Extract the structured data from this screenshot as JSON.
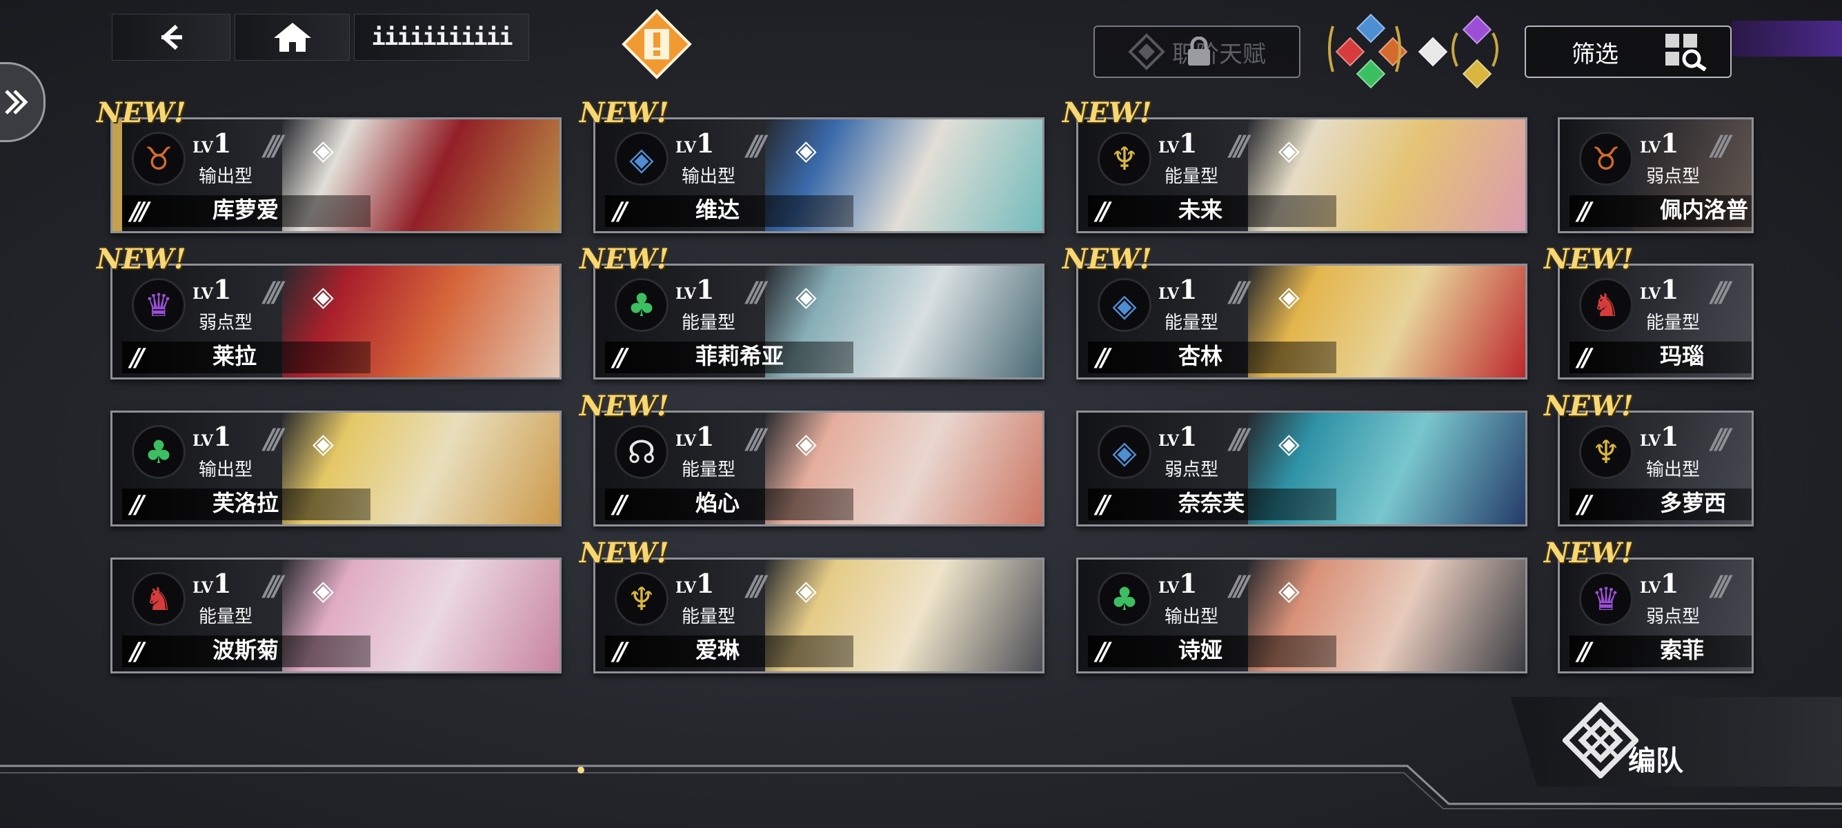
{
  "topbar": {
    "back_icon": "chevron-left-icon",
    "home_icon": "home-icon",
    "title": "iiiiiiiiiii",
    "alert_icon": "exclamation-diamond-icon",
    "locked_label": "职阶天赋",
    "filter_label": "筛选",
    "filter_icon": "grid-search-icon"
  },
  "side": {
    "expand_icon": "double-chevron-right-icon"
  },
  "new_label": "NEW!",
  "lv_prefix": "LV",
  "cards": [
    {
      "name": "库萝爱",
      "role": "输出型",
      "level": "1",
      "stars": "///",
      "is_new": true,
      "emblem": "demon-icon",
      "emblem_color": "#d46a2e",
      "accent": true,
      "art": [
        "#f2efe7",
        "#9b1d26",
        "#c99b47"
      ]
    },
    {
      "name": "维达",
      "role": "输出型",
      "level": "1",
      "stars": "//",
      "is_new": true,
      "emblem": "shield-icon",
      "emblem_color": "#4e8fd4",
      "accent": false,
      "art": [
        "#3b6fb5",
        "#f1ede4",
        "#78c6c6"
      ]
    },
    {
      "name": "未来",
      "role": "能量型",
      "level": "1",
      "stars": "//",
      "is_new": true,
      "emblem": "chalice-icon",
      "emblem_color": "#d8b640",
      "accent": false,
      "art": [
        "#f6ecd4",
        "#f4d07a",
        "#e8a3b8"
      ]
    },
    {
      "name": "佩内洛普",
      "role": "弱点型",
      "level": "1",
      "stars": "//",
      "is_new": false,
      "emblem": "demon-icon",
      "emblem_color": "#d46a2e",
      "accent": false,
      "art": [
        "#3a2f2c",
        "#6d5544",
        "#b48b6a"
      ]
    },
    {
      "name": "莱拉",
      "role": "弱点型",
      "level": "1",
      "stars": "//",
      "is_new": true,
      "emblem": "crown-icon",
      "emblem_color": "#9b4fd6",
      "accent": false,
      "art": [
        "#b51f2b",
        "#e46a3a",
        "#f1d3bf"
      ]
    },
    {
      "name": "菲莉希亚",
      "role": "能量型",
      "level": "1",
      "stars": "//",
      "is_new": true,
      "emblem": "tree-icon",
      "emblem_color": "#3cbf62",
      "accent": false,
      "art": [
        "#8fb9c2",
        "#e6eef0",
        "#4b6d78"
      ]
    },
    {
      "name": "杏林",
      "role": "能量型",
      "level": "1",
      "stars": "//",
      "is_new": true,
      "emblem": "shield-icon",
      "emblem_color": "#4e8fd4",
      "accent": false,
      "art": [
        "#f4c14f",
        "#f7e1a2",
        "#c8262b"
      ]
    },
    {
      "name": "玛瑙",
      "role": "能量型",
      "level": "1",
      "stars": "//",
      "is_new": true,
      "emblem": "wolf-icon",
      "emblem_color": "#d63c3c",
      "accent": false,
      "art": [
        "#2a2c31",
        "#43464c",
        "#5d6067"
      ]
    },
    {
      "name": "芙洛拉",
      "role": "输出型",
      "level": "1",
      "stars": "//",
      "is_new": false,
      "emblem": "tree-icon",
      "emblem_color": "#3cbf62",
      "accent": false,
      "art": [
        "#f5d56a",
        "#f8edc7",
        "#d8a04a"
      ]
    },
    {
      "name": "焰心",
      "role": "能量型",
      "level": "1",
      "stars": "//",
      "is_new": true,
      "emblem": "halo-wing-icon",
      "emblem_color": "#e8e8e8",
      "accent": false,
      "art": [
        "#f5b9a6",
        "#f9e4dc",
        "#d87a64"
      ]
    },
    {
      "name": "奈奈芙",
      "role": "弱点型",
      "level": "1",
      "stars": "//",
      "is_new": false,
      "emblem": "shield-icon",
      "emblem_color": "#4e8fd4",
      "accent": false,
      "art": [
        "#2f9bb0",
        "#7fd3da",
        "#223a6b"
      ]
    },
    {
      "name": "多萝西",
      "role": "输出型",
      "level": "1",
      "stars": "//",
      "is_new": true,
      "emblem": "chalice-icon",
      "emblem_color": "#d8b640",
      "accent": false,
      "art": [
        "#2a2c31",
        "#43464c",
        "#5d6067"
      ]
    },
    {
      "name": "波斯菊",
      "role": "能量型",
      "level": "1",
      "stars": "//",
      "is_new": false,
      "emblem": "wolf-icon",
      "emblem_color": "#d63c3c",
      "accent": false,
      "art": [
        "#f0b7d1",
        "#fbe6ef",
        "#d48aa9"
      ]
    },
    {
      "name": "爱琳",
      "role": "能量型",
      "level": "1",
      "stars": "//",
      "is_new": true,
      "emblem": "chalice-icon",
      "emblem_color": "#d8b640",
      "accent": false,
      "art": [
        "#f5d98e",
        "#fff3d6",
        "#4d4f57"
      ]
    },
    {
      "name": "诗娅",
      "role": "输出型",
      "level": "1",
      "stars": "//",
      "is_new": false,
      "emblem": "tree-icon",
      "emblem_color": "#3cbf62",
      "accent": false,
      "art": [
        "#e89a7e",
        "#f7d8c8",
        "#3a3c42"
      ]
    },
    {
      "name": "索菲",
      "role": "弱点型",
      "level": "1",
      "stars": "//",
      "is_new": true,
      "emblem": "crown-icon",
      "emblem_color": "#9b4fd6",
      "accent": false,
      "art": [
        "#2a2c31",
        "#43464c",
        "#5d6067"
      ]
    }
  ],
  "team_button": {
    "label": "编队",
    "icon": "knot-emblem-icon"
  },
  "element_gems": [
    {
      "color": "#4e8fd4"
    },
    {
      "color": "#d63c3c"
    },
    {
      "color": "#d46a2e"
    },
    {
      "color": "#3cbf62"
    },
    {
      "color": "#e8e8e8"
    },
    {
      "color": "#9b4fd6"
    },
    {
      "color": "#d8b640"
    }
  ]
}
